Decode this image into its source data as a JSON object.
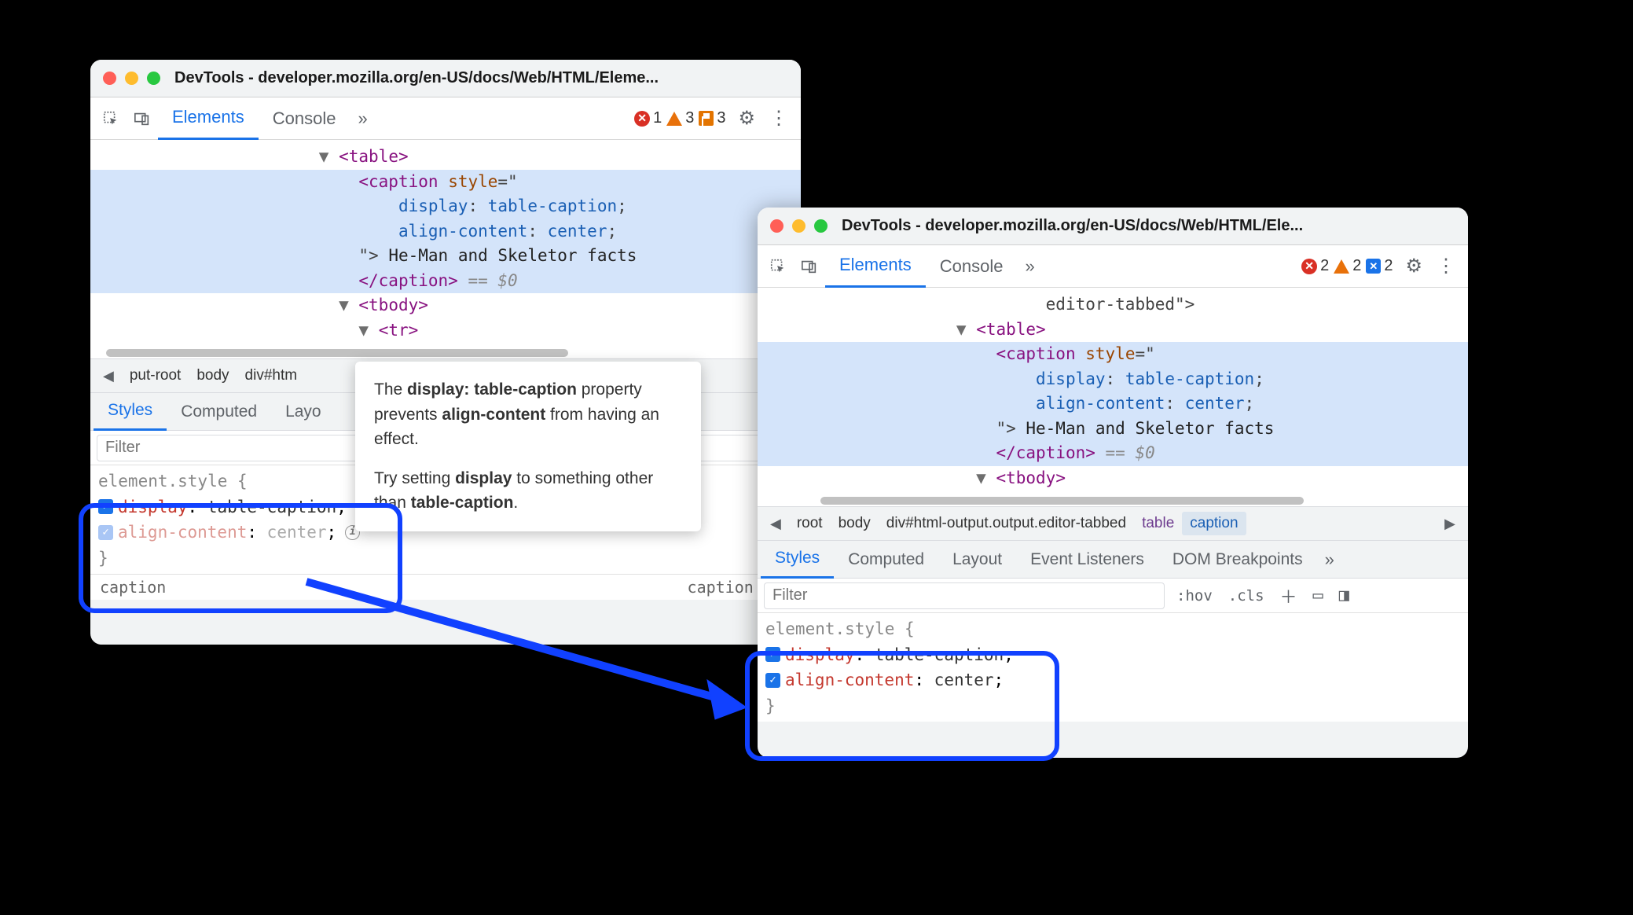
{
  "window1": {
    "title": "DevTools - developer.mozilla.org/en-US/docs/Web/HTML/Eleme...",
    "tabs": {
      "active": "Elements",
      "other": "Console"
    },
    "counts": {
      "errors": "1",
      "warnings": "3",
      "flags": "3"
    },
    "dom": {
      "table_open": "<table>",
      "caption_open": "<caption",
      "style_attr": "style",
      "style_open_q": "=\"",
      "display_prop": "display",
      "display_val": "table-caption",
      "align_prop": "align-content",
      "align_val": "center",
      "close_q": "\">",
      "caption_text": " He-Man and Skeletor facts",
      "caption_close": "</caption>",
      "sel_marker": "== $0",
      "tbody_open": "<tbody>",
      "tr_open": "<tr>"
    },
    "crumbs": {
      "c1": "put-root",
      "c2": "body",
      "c3": "div#htm"
    },
    "subtabs": {
      "styles": "Styles",
      "computed": "Computed",
      "layout": "Layo"
    },
    "filter_placeholder": "Filter",
    "styles": {
      "selector": "element.style {",
      "p1_name": "display",
      "p1_val": "table-caption",
      "p2_name": "align-content",
      "p2_val": "center",
      "close": "}"
    },
    "cutoff": {
      "left": "caption",
      "right": "caption htm"
    }
  },
  "window2": {
    "title": "DevTools - developer.mozilla.org/en-US/docs/Web/HTML/Ele...",
    "tabs": {
      "active": "Elements",
      "other": "Console"
    },
    "counts": {
      "errors": "2",
      "warnings": "2",
      "issues": "2"
    },
    "dom": {
      "prev_line": "editor-tabbed\">",
      "table_open": "<table>",
      "caption_open": "<caption",
      "style_attr": "style",
      "style_open_q": "=\"",
      "display_prop": "display",
      "display_val": "table-caption",
      "align_prop": "align-content",
      "align_val": "center",
      "close_q": "\">",
      "caption_text": " He-Man and Skeletor facts",
      "caption_close": "</caption>",
      "sel_marker": "== $0",
      "tbody_open": "<tbody>"
    },
    "crumbs": {
      "c1": "root",
      "c2": "body",
      "c3": "div#html-output.output.editor-tabbed",
      "c4": "table",
      "c5": "caption"
    },
    "subtabs": {
      "styles": "Styles",
      "computed": "Computed",
      "layout": "Layout",
      "ev": "Event Listeners",
      "dom": "DOM Breakpoints"
    },
    "filter_placeholder": "Filter",
    "filter_actions": {
      "hov": ":hov",
      "cls": ".cls"
    },
    "styles": {
      "selector": "element.style {",
      "p1_name": "display",
      "p1_val": "table-caption",
      "p2_name": "align-content",
      "p2_val": "center",
      "close": "}"
    }
  },
  "tooltip": {
    "t1a": "The ",
    "t1b": "display: table-caption",
    "t1c": " property prevents ",
    "t1d": "align-content",
    "t1e": " from having an effect.",
    "t2a": "Try setting ",
    "t2b": "display",
    "t2c": " to something other than ",
    "t2d": "table-caption",
    "t2e": "."
  }
}
